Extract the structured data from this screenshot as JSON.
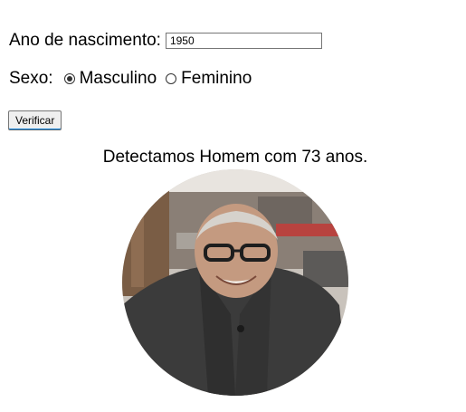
{
  "form": {
    "year_label": "Ano de nascimento:",
    "year_value": "1950",
    "sex_label": "Sexo:",
    "options": [
      {
        "label": "Masculino",
        "selected": true
      },
      {
        "label": "Feminino",
        "selected": false
      }
    ],
    "verify_label": "Verificar"
  },
  "result": {
    "text": "Detectamos Homem com 73 anos."
  }
}
